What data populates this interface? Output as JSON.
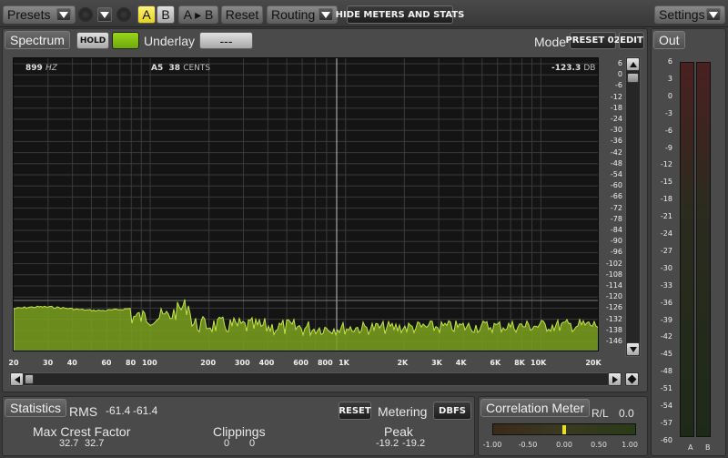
{
  "toolbar": {
    "presets_label": "Presets",
    "a_label": "A",
    "b_label": "B",
    "a_to_b_label": "A ▸ B",
    "reset_label": "Reset",
    "routing_label": "Routing",
    "hide_meters_label": "HIDE METERS AND STATS",
    "settings_label": "Settings"
  },
  "spectrum": {
    "tab_label": "Spectrum",
    "hold_label": "HOLD",
    "underlay_label": "Underlay",
    "underlay_value": "---",
    "mode_label": "Mode",
    "mode_value": "PRESET 02",
    "edit_label": "EDIT",
    "readout_freq": "899",
    "readout_freq_unit": "HZ",
    "readout_note": "A5",
    "readout_cents": "38",
    "readout_cents_unit": "CENTS",
    "readout_db": "-123.3",
    "readout_db_unit": "DB",
    "db_ticks": [
      "6",
      "0",
      "-6",
      "-12",
      "-18",
      "-24",
      "-30",
      "-36",
      "-42",
      "-48",
      "-54",
      "-60",
      "-66",
      "-72",
      "-78",
      "-84",
      "-90",
      "-96",
      "-102",
      "-108",
      "-114",
      "-120",
      "-126",
      "-132",
      "-138",
      "-146"
    ],
    "freq_ticks": [
      "20",
      "30",
      "40",
      "60",
      "80",
      "100",
      "200",
      "300",
      "400",
      "600",
      "800",
      "1K",
      "2K",
      "3K",
      "4K",
      "6K",
      "8K",
      "10K",
      "20K"
    ]
  },
  "out": {
    "tab_label": "Out",
    "ticks": [
      "6",
      "3",
      "0",
      "-3",
      "-6",
      "-9",
      "-12",
      "-15",
      "-18",
      "-21",
      "-24",
      "-27",
      "-30",
      "-33",
      "-36",
      "-39",
      "-42",
      "-45",
      "-48",
      "-51",
      "-54",
      "-57",
      "-60"
    ],
    "channel_a": "A",
    "channel_b": "B"
  },
  "statistics": {
    "tab_label": "Statistics",
    "rms_label": "RMS",
    "rms_left": "-61.4",
    "rms_right": "-61.4",
    "reset_label": "RESET",
    "metering_label": "Metering",
    "metering_value": "DBFS",
    "crest_label": "Max Crest Factor",
    "crest_left": "32.7",
    "crest_right": "32.7",
    "clippings_label": "Clippings",
    "clip_left": "0",
    "clip_right": "0",
    "peak_label": "Peak",
    "peak_left": "-19.2",
    "peak_right": "-19.2"
  },
  "correlation": {
    "tab_label": "Correlation Meter",
    "rl_label": "R/L",
    "value": "0.0",
    "ticks": [
      "-1.00",
      "-0.50",
      "0.00",
      "0.50",
      "1.00"
    ]
  }
}
